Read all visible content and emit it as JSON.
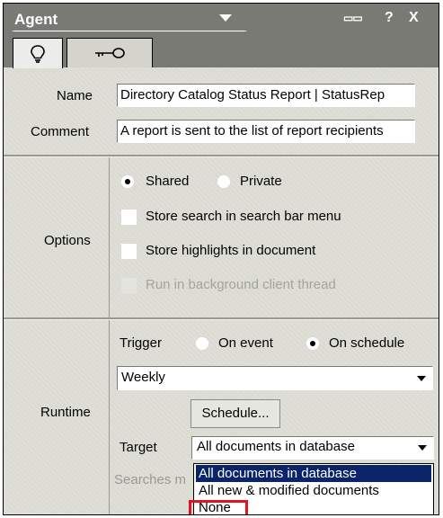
{
  "window": {
    "title": "Agent",
    "controls": [
      "▭▭",
      "?",
      "X"
    ]
  },
  "tabs": [
    {
      "icon": "lightbulb-icon",
      "active": true
    },
    {
      "icon": "key-icon",
      "active": false
    }
  ],
  "name": {
    "label": "Name",
    "value": "Directory Catalog Status Report | StatusRep"
  },
  "comment": {
    "label": "Comment",
    "value": "A report is sent to the list of report recipients"
  },
  "options": {
    "label": "Options",
    "shared_label": "Shared",
    "private_label": "Private",
    "shared_selected": true,
    "store_search_label": "Store search in search bar menu",
    "store_highlights_label": "Store highlights in document",
    "run_background_label": "Run in background client thread"
  },
  "runtime": {
    "label": "Runtime",
    "trigger_label": "Trigger",
    "on_event_label": "On event",
    "on_schedule_label": "On schedule",
    "on_schedule_selected": true,
    "schedule_value": "Weekly",
    "schedule_button": "Schedule...",
    "target_label": "Target",
    "target_value": "All documents in database",
    "searches_text": "Searches m",
    "target_options": [
      "All documents in database",
      "All new & modified documents",
      "None"
    ],
    "target_highlighted": "All documents in database"
  }
}
